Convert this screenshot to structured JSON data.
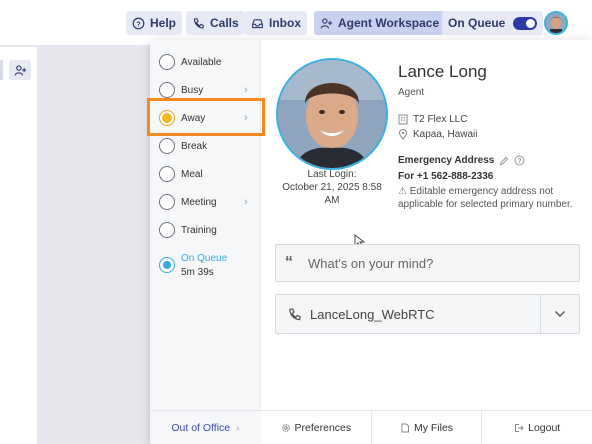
{
  "topbar": {
    "help_label": "Help",
    "calls_label": "Calls",
    "inbox_label": "Inbox",
    "workspace_label": "Agent Workspace",
    "queue_label": "On Queue"
  },
  "status": {
    "items": [
      {
        "label": "Available"
      },
      {
        "label": "Busy"
      },
      {
        "label": "Away"
      },
      {
        "label": "Break"
      },
      {
        "label": "Meal"
      },
      {
        "label": "Meeting"
      },
      {
        "label": "Training"
      }
    ],
    "on_queue_label": "On Queue",
    "on_queue_time": "5m 39s",
    "out_of_office": "Out of Office"
  },
  "profile": {
    "name": "Lance Long",
    "role": "Agent",
    "org": "T2 Flex LLC",
    "location": "Kapaa, Hawaii",
    "emergency_title": "Emergency Address",
    "emergency_number": "For +1 562-888-2336",
    "emergency_note": "Editable emergency address not applicable for selected primary number.",
    "last_login_label": "Last Login:",
    "last_login_value": "October 21, 2025 8:58 AM"
  },
  "mind_placeholder": "What's on your mind?",
  "phone": {
    "station": "LanceLong_WebRTC"
  },
  "footer": {
    "preferences": "Preferences",
    "files": "My Files",
    "logout": "Logout"
  },
  "colors": {
    "accent": "#36a9e1",
    "highlight": "#f5891f",
    "away": "#f5b71e",
    "nav": "#2d3aa6"
  }
}
